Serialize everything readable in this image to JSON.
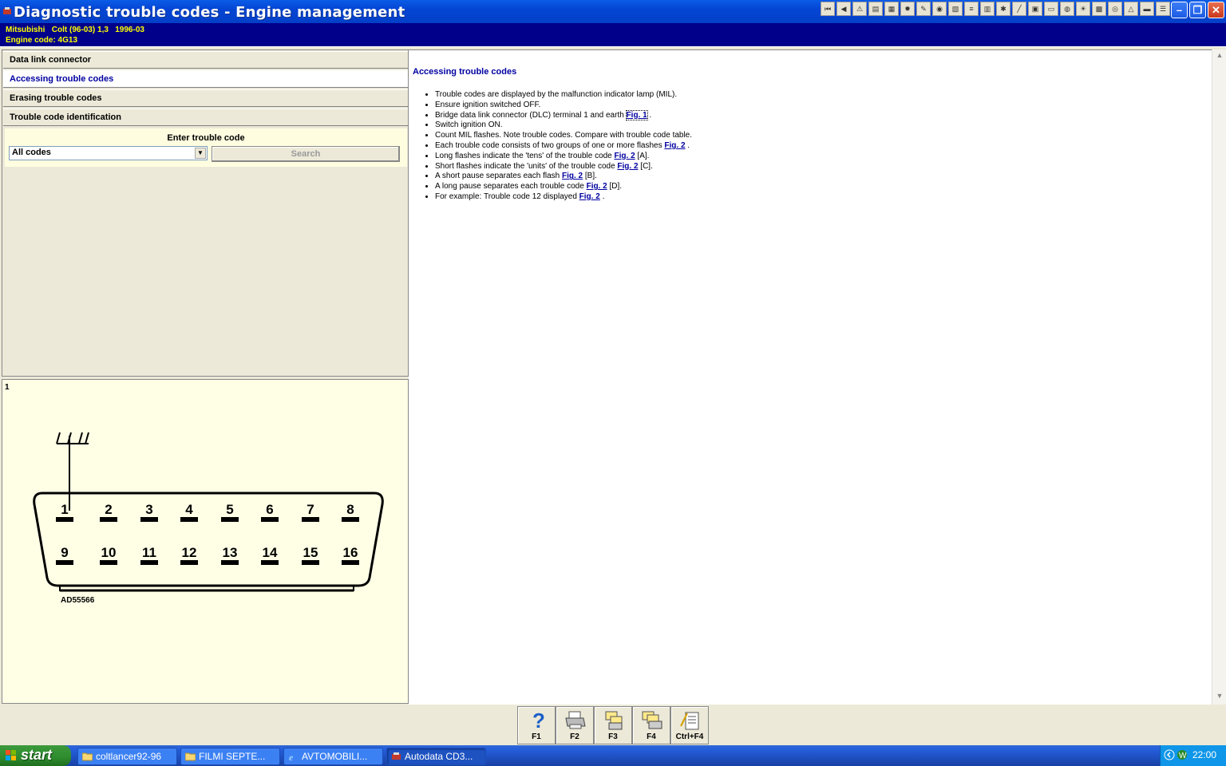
{
  "window": {
    "title": "Diagnostic trouble codes - Engine management"
  },
  "vehicle": {
    "line1": "Mitsubishi   Colt (96-03) 1,3   1996-03",
    "line2": "Engine code: 4G13"
  },
  "nav": {
    "items": [
      {
        "label": "Data link connector",
        "active": false
      },
      {
        "label": "Accessing trouble codes",
        "active": true
      },
      {
        "label": "Erasing trouble codes",
        "active": false
      },
      {
        "label": "Trouble code identification",
        "active": false
      }
    ]
  },
  "search": {
    "label": "Enter trouble code",
    "selected_value": "All codes",
    "button_label": "Search"
  },
  "figure": {
    "number": "1",
    "pin_labels": [
      "1",
      "2",
      "3",
      "4",
      "5",
      "6",
      "7",
      "8",
      "9",
      "10",
      "11",
      "12",
      "13",
      "14",
      "15",
      "16"
    ],
    "caption": "AD55566"
  },
  "content": {
    "title": "Accessing trouble codes",
    "bullets": [
      {
        "text": "Trouble codes are displayed by the malfunction indicator lamp (MIL).",
        "link": "",
        "suffix": ""
      },
      {
        "text": "Ensure ignition switched OFF.",
        "link": "",
        "suffix": ""
      },
      {
        "text": "Bridge data link connector (DLC) terminal 1 and earth ",
        "link": "Fig. 1",
        "suffix": " ."
      },
      {
        "text": "Switch ignition ON.",
        "link": "",
        "suffix": ""
      },
      {
        "text": "Count MIL flashes. Note trouble codes. Compare with trouble code table.",
        "link": "",
        "suffix": ""
      },
      {
        "text": "Each trouble code consists of two groups of one or more flashes ",
        "link": "Fig. 2",
        "suffix": " ."
      },
      {
        "text": "Long flashes indicate the 'tens' of the trouble code ",
        "link": "Fig. 2",
        "suffix": " [A]."
      },
      {
        "text": "Short flashes indicate the 'units' of the trouble code ",
        "link": "Fig. 2",
        "suffix": " [C]."
      },
      {
        "text": "A short pause separates each flash ",
        "link": "Fig. 2",
        "suffix": " [B]."
      },
      {
        "text": "A long pause separates each trouble code ",
        "link": "Fig. 2",
        "suffix": " [D]."
      },
      {
        "text": "For example: Trouble code 12 displayed ",
        "link": "Fig. 2",
        "suffix": " ."
      }
    ]
  },
  "fkeys": [
    {
      "label": "F1",
      "icon": "help-icon"
    },
    {
      "label": "F2",
      "icon": "printer-icon"
    },
    {
      "label": "F3",
      "icon": "print-preview-icon"
    },
    {
      "label": "F4",
      "icon": "print-all-icon"
    },
    {
      "label": "Ctrl+F4",
      "icon": "notes-icon"
    }
  ],
  "taskbar": {
    "start_label": "start",
    "tasks": [
      {
        "label": "coltlancer92-96",
        "icon": "folder-icon",
        "active": false
      },
      {
        "label": "FILMI SEPTE...",
        "icon": "folder-icon",
        "active": false
      },
      {
        "label": "AVTOMOBILI...",
        "icon": "ie-icon",
        "active": false
      },
      {
        "label": "Autodata CD3...",
        "icon": "autodata-icon",
        "active": true
      }
    ],
    "clock": "22:00"
  },
  "colors": {
    "title_bar": "#0445d4",
    "vehicle_bar": "#00008b",
    "vehicle_text": "#ffff00",
    "link": "#0000a0",
    "figure_bg": "#ffffe6"
  }
}
